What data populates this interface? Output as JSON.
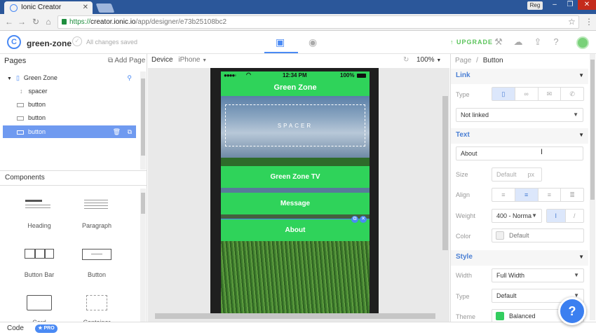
{
  "browser": {
    "tab_title": "Ionic Creator",
    "user_badge": "Reg",
    "url_scheme": "https://",
    "url_host": "creator.ionic.io",
    "url_path": "/app/designer/e73b25108bc2"
  },
  "header": {
    "project_name": "green-zone",
    "save_status": "All changes saved",
    "upgrade_label": "UPGRADE"
  },
  "left": {
    "pages_title": "Pages",
    "add_page_label": "Add Page",
    "tree": [
      {
        "label": "Green Zone"
      },
      {
        "label": "spacer"
      },
      {
        "label": "button"
      },
      {
        "label": "button"
      },
      {
        "label": "button"
      }
    ],
    "components_title": "Components",
    "components": [
      {
        "label": "Heading"
      },
      {
        "label": "Paragraph"
      },
      {
        "label": "Button Bar"
      },
      {
        "label": "Button"
      },
      {
        "label": "Card"
      },
      {
        "label": "Container"
      }
    ]
  },
  "center": {
    "device_label": "Device",
    "device_value": "iPhone",
    "zoom": "100%",
    "phone": {
      "time": "12:34 PM",
      "battery": "100%",
      "title": "Green Zone",
      "spacer_label": "SPACER",
      "buttons": [
        "Green Zone TV",
        "Message",
        "About"
      ]
    }
  },
  "right": {
    "breadcrumb_root": "Page",
    "breadcrumb_sep": "/",
    "breadcrumb_current": "Button",
    "link": {
      "title": "Link",
      "type_label": "Type",
      "select_value": "Not linked"
    },
    "text": {
      "title": "Text",
      "value": "About",
      "size_label": "Size",
      "size_placeholder": "Default",
      "size_unit": "px",
      "align_label": "Align",
      "weight_label": "Weight",
      "weight_value": "400 - Norma",
      "italic_glyph": "I",
      "color_label": "Color",
      "color_value": "Default"
    },
    "style": {
      "title": "Style",
      "width_label": "Width",
      "width_value": "Full Width",
      "type_label": "Type",
      "type_value": "Default",
      "theme_label": "Theme",
      "theme_value": "Balanced",
      "theme_color": "#33cd5f"
    }
  },
  "bottom": {
    "code_label": "Code",
    "pro_label": "★ PRO",
    "help_glyph": "?"
  }
}
